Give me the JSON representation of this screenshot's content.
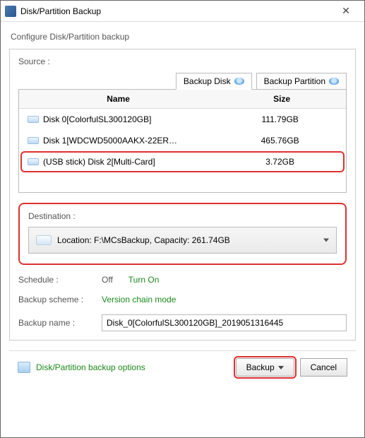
{
  "window": {
    "title": "Disk/Partition Backup",
    "subtitle": "Configure Disk/Partition backup"
  },
  "source": {
    "label": "Source :",
    "tabs": {
      "disk": "Backup Disk",
      "partition": "Backup Partition"
    },
    "columns": {
      "name": "Name",
      "size": "Size"
    },
    "rows": [
      {
        "name": "Disk 0[ColorfulSL300120GB]",
        "size": "111.79GB"
      },
      {
        "name": "Disk 1[WDCWD5000AAKX-22ER…",
        "size": "465.76GB"
      },
      {
        "name": "(USB stick) Disk 2[Multi-Card]",
        "size": "3.72GB"
      }
    ]
  },
  "destination": {
    "label": "Destination :",
    "value": "Location: F:\\MCsBackup, Capacity: 261.74GB"
  },
  "schedule": {
    "label": "Schedule :",
    "status": "Off",
    "link": "Turn On"
  },
  "scheme": {
    "label": "Backup scheme :",
    "value": "Version chain mode"
  },
  "name": {
    "label": "Backup name :",
    "value": "Disk_0[ColorfulSL300120GB]_2019051316445"
  },
  "footer": {
    "options": "Disk/Partition backup options",
    "backup": "Backup",
    "cancel": "Cancel"
  }
}
